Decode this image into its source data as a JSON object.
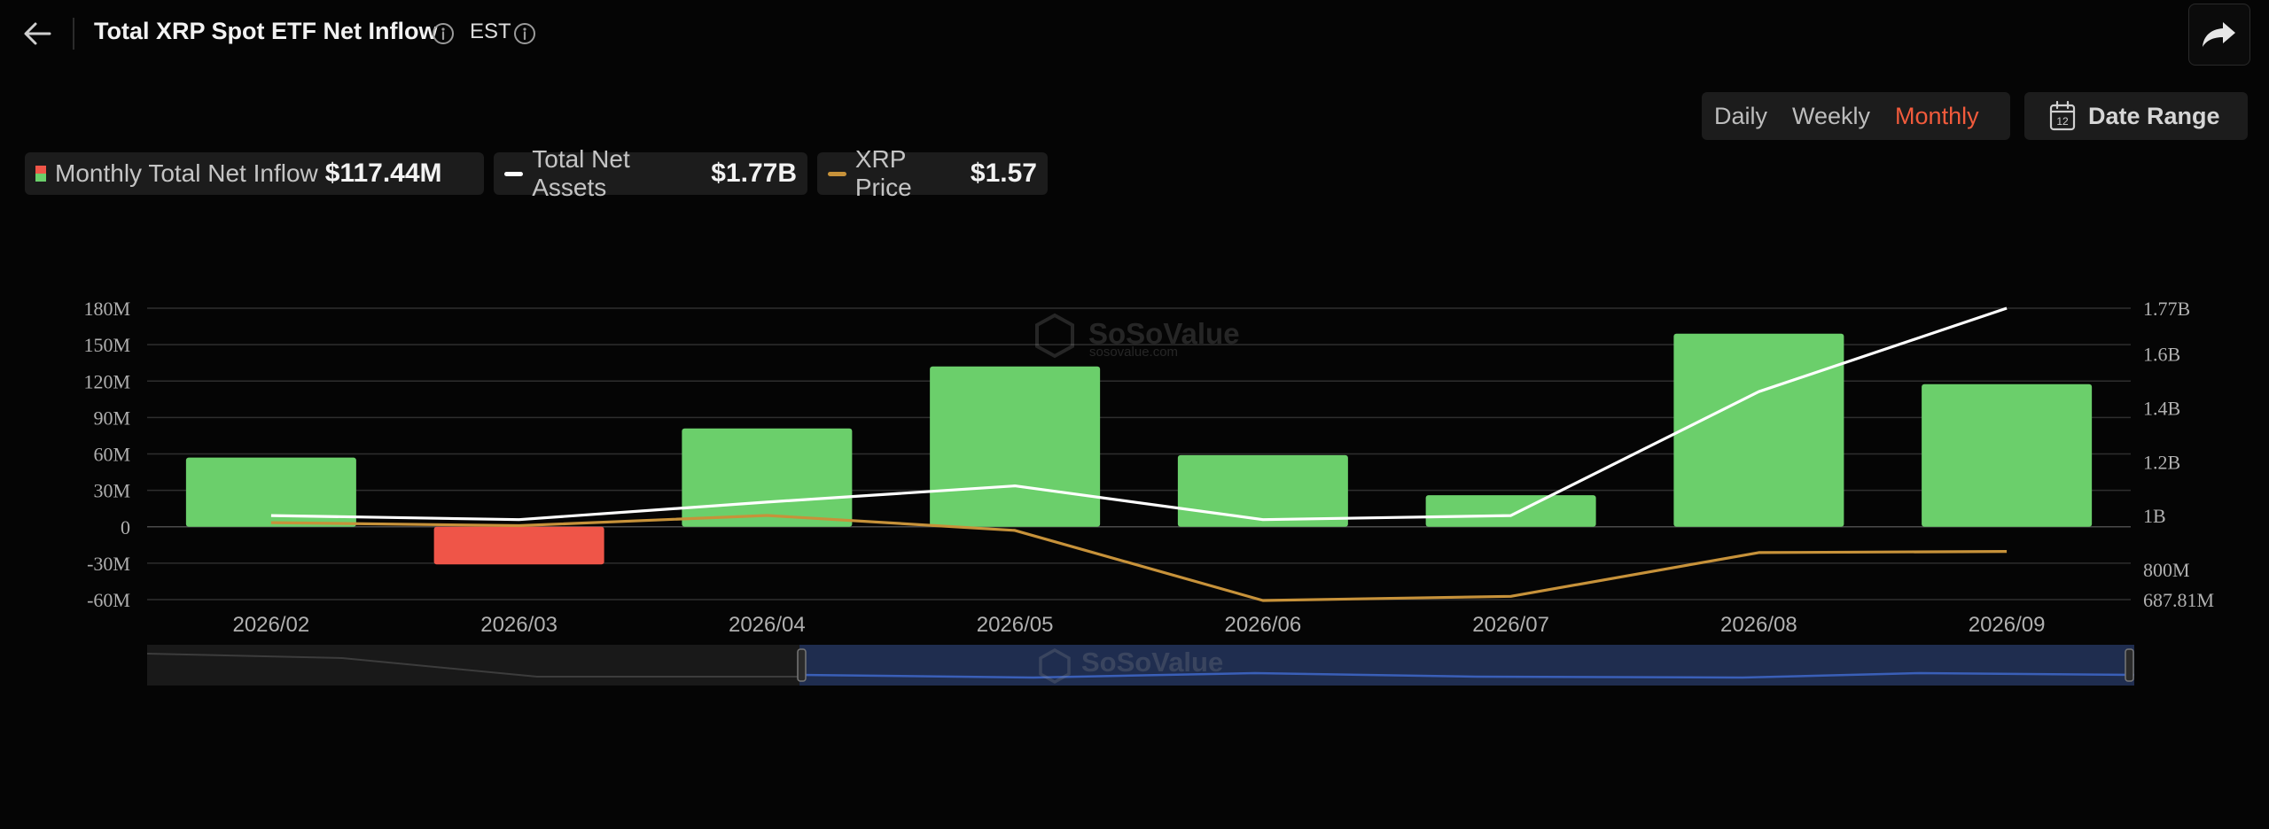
{
  "header": {
    "title": "Total XRP Spot ETF Net Inflow",
    "timezone": "EST"
  },
  "controls": {
    "periods": [
      "Daily",
      "Weekly",
      "Monthly"
    ],
    "active_period": "Monthly",
    "date_range_label": "Date Range",
    "calendar_day": "12"
  },
  "legend": [
    {
      "name": "Monthly Total Net Inflow",
      "value": "$117.44M"
    },
    {
      "name": "Total Net Assets",
      "value": "$1.77B"
    },
    {
      "name": "XRP Price",
      "value": "$1.57"
    }
  ],
  "watermark": {
    "brand": "SoSoValue",
    "url": "sosovalue.com"
  },
  "colors": {
    "positive_bar": "#6bcf6b",
    "negative_bar": "#ef5548",
    "net_assets_line": "#ffffff",
    "price_line": "#c7923a",
    "active_period": "#f25b3c",
    "zoom_selection": "#1f2d4f"
  },
  "chart_data": {
    "type": "bar",
    "categories": [
      "2026/02",
      "2026/03",
      "2026/04",
      "2026/05",
      "2026/06",
      "2026/07",
      "2026/08",
      "2026/09"
    ],
    "series": [
      {
        "name": "Monthly Total Net Inflow",
        "type": "bar",
        "axis": "left",
        "values": [
          57,
          -31,
          81,
          132,
          59,
          26,
          159,
          117.44
        ]
      },
      {
        "name": "Total Net Assets",
        "type": "line",
        "axis": "right",
        "values": [
          1.0,
          0.985,
          1.05,
          1.11,
          0.985,
          1.0,
          1.46,
          1.77
        ]
      },
      {
        "name": "XRP Price",
        "type": "line",
        "axis": "none",
        "values": [
          2.05,
          2.0,
          2.17,
          1.92,
          0.75,
          0.82,
          1.55,
          1.57
        ]
      }
    ],
    "y_left": {
      "ticks": [
        "180M",
        "150M",
        "120M",
        "90M",
        "60M",
        "30M",
        "0",
        "-30M",
        "-60M"
      ],
      "range": [
        -60,
        180
      ],
      "unit": "M"
    },
    "y_right": {
      "ticks": [
        "1.77B",
        "1.6B",
        "1.4B",
        "1.2B",
        "1B",
        "800M",
        "687.81M"
      ],
      "range": [
        0.68781,
        1.77
      ]
    },
    "grid": true
  }
}
